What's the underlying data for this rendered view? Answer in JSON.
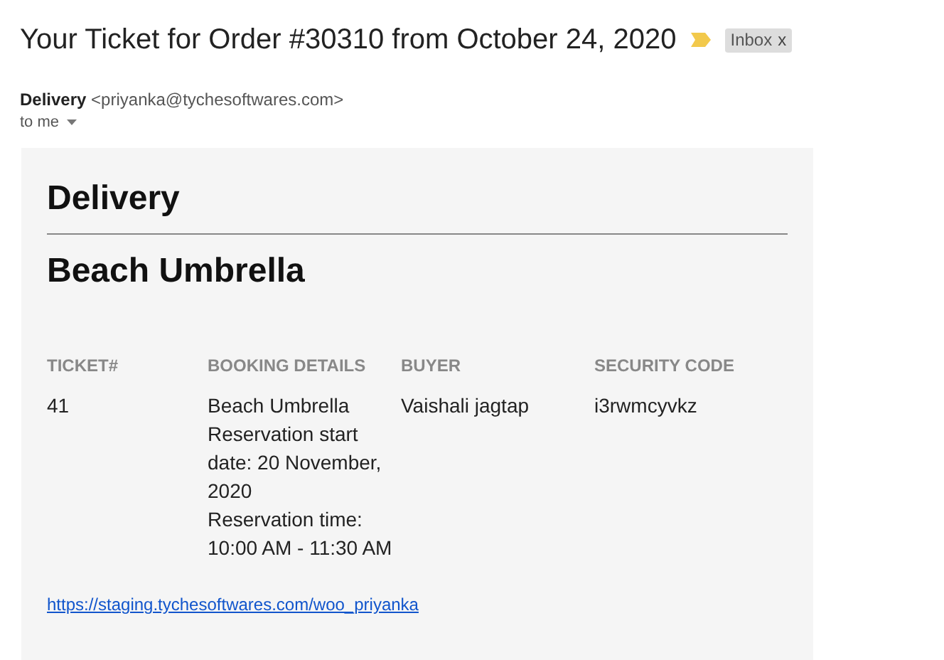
{
  "subject": "Your Ticket for Order #30310 from October 24, 2020",
  "label": {
    "text": "Inbox",
    "remove": "x"
  },
  "sender": {
    "name": "Delivery",
    "email": "<priyanka@tychesoftwares.com>",
    "recipient": "to me"
  },
  "body": {
    "heading": "Delivery",
    "product": "Beach Umbrella",
    "table": {
      "columns": [
        "TICKET#",
        "BOOKING DETAILS",
        "BUYER",
        "SECURITY CODE"
      ],
      "rows": [
        {
          "ticket": "41",
          "booking_details": [
            "Beach Umbrella",
            "Reservation start date: 20 November, 2020",
            "Reservation time: 10:00 AM - 11:30 AM"
          ],
          "buyer": "Vaishali jagtap",
          "security_code": "i3rwmcyvkz"
        }
      ]
    },
    "link": "https://staging.tychesoftwares.com/woo_priyanka"
  }
}
